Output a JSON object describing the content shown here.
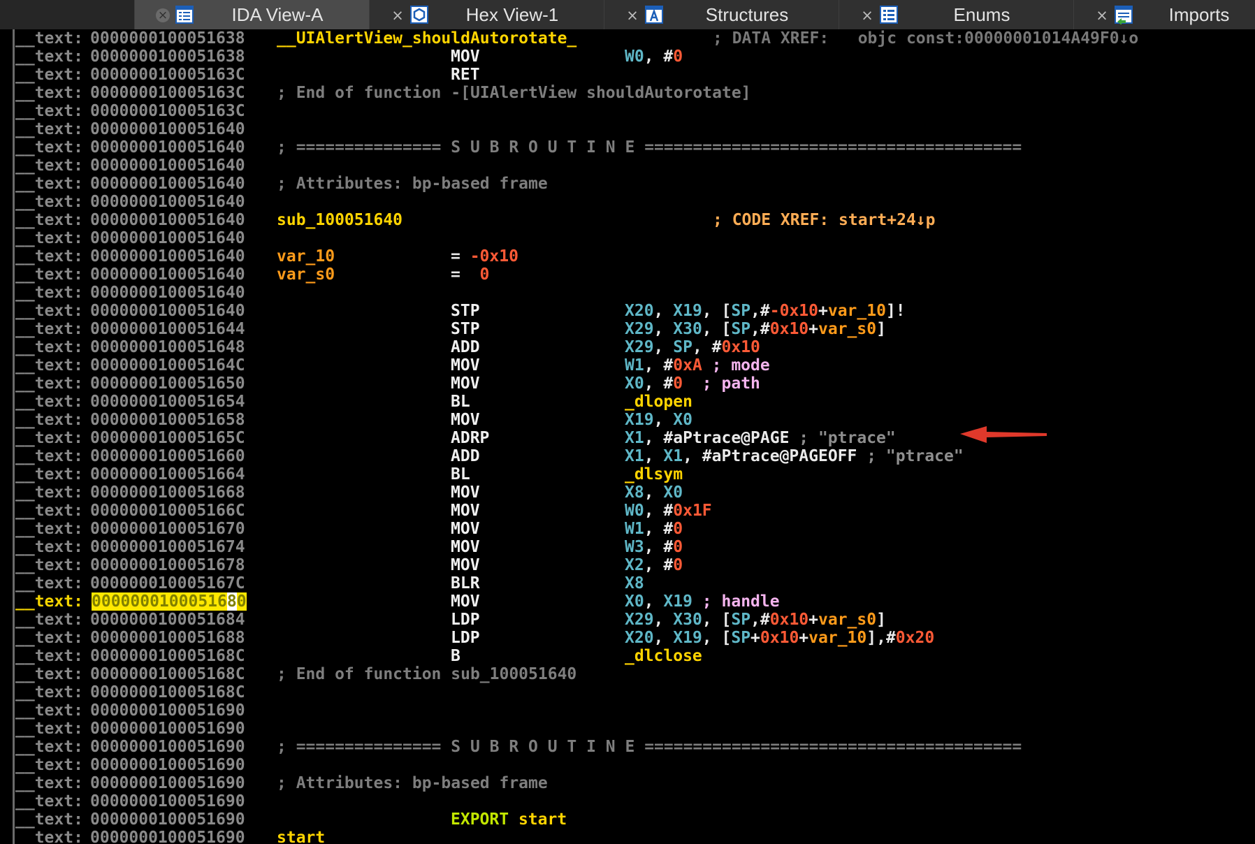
{
  "tabs": [
    {
      "label": "IDA View-A",
      "icon": "ida-view-icon",
      "active": true
    },
    {
      "label": "Hex View-1",
      "icon": "hex-view-icon",
      "active": false
    },
    {
      "label": "Structures",
      "icon": "structures-icon",
      "active": false
    },
    {
      "label": "Enums",
      "icon": "enums-icon",
      "active": false
    },
    {
      "label": "Imports",
      "icon": "imports-icon",
      "active": false
    }
  ],
  "close_glyph": "×",
  "segment": "__text:",
  "highlighted_line": {
    "addr_before_cursor": "00000001000516",
    "cursor_char": "8",
    "addr_after_cursor": "0"
  },
  "lines": [
    {
      "addr": "000000010005163 8",
      "label": "__UIAlertView_shouldAutorotate_",
      "xref": "; DATA XREF:   objc const:00000001014A49F0↓o"
    },
    {
      "addr": "0000000100051638",
      "mnem": "MOV",
      "ops": "W0, #0"
    },
    {
      "addr": "000000010005163C",
      "mnem": "RET"
    },
    {
      "addr": "000000010005163C",
      "comment": "; End of function -[UIAlertView shouldAutorotate]"
    },
    {
      "addr": "000000010005163C"
    },
    {
      "addr": "0000000100051640"
    },
    {
      "addr": "0000000100051640",
      "comment": "; =============== S U B R O U T I N E ======================================="
    },
    {
      "addr": "0000000100051640"
    },
    {
      "addr": "0000000100051640",
      "comment": "; Attributes: bp-based frame"
    },
    {
      "addr": "0000000100051640"
    },
    {
      "addr": "0000000100051640",
      "label": "sub_100051640",
      "xref": "; CODE XREF: start+24↓p"
    },
    {
      "addr": "0000000100051640"
    },
    {
      "addr": "0000000100051640",
      "label": "var_10",
      "mnem": "= -0x10"
    },
    {
      "addr": "0000000100051640",
      "label": "var_s0",
      "mnem": "=  0"
    },
    {
      "addr": "0000000100051640"
    },
    {
      "addr": "0000000100051640",
      "mnem": "STP",
      "ops": "X20, X19, [SP,#-0x10+var_10]!"
    },
    {
      "addr": "0000000100051644",
      "mnem": "STP",
      "ops": "X29, X30, [SP,#0x10+var_s0]"
    },
    {
      "addr": "0000000100051648",
      "mnem": "ADD",
      "ops": "X29, SP, #0x10"
    },
    {
      "addr": "000000010005164C",
      "mnem": "MOV",
      "ops": "W1, #0xA ; mode"
    },
    {
      "addr": "0000000100051650",
      "mnem": "MOV",
      "ops": "X0, #0  ; path"
    },
    {
      "addr": "0000000100051654",
      "mnem": "BL",
      "ops": "_dlopen"
    },
    {
      "addr": "0000000100051658",
      "mnem": "MOV",
      "ops": "X19, X0"
    },
    {
      "addr": "000000010005165C",
      "mnem": "ADRP",
      "ops": "X1, #aPtrace@PAGE ; \"ptrace\""
    },
    {
      "addr": "0000000100051660",
      "mnem": "ADD",
      "ops": "X1, X1, #aPtrace@PAGEOFF ; \"ptrace\""
    },
    {
      "addr": "0000000100051664",
      "mnem": "BL",
      "ops": "_dlsym"
    },
    {
      "addr": "0000000100051668",
      "mnem": "MOV",
      "ops": "X8, X0"
    },
    {
      "addr": "000000010005166C",
      "mnem": "MOV",
      "ops": "W0, #0x1F"
    },
    {
      "addr": "0000000100051670",
      "mnem": "MOV",
      "ops": "W1, #0"
    },
    {
      "addr": "0000000100051674",
      "mnem": "MOV",
      "ops": "W3, #0"
    },
    {
      "addr": "0000000100051678",
      "mnem": "MOV",
      "ops": "X2, #0"
    },
    {
      "addr": "000000010005167C",
      "mnem": "BLR",
      "ops": "X8"
    },
    {
      "addr": "0000000100051680",
      "mnem": "MOV",
      "ops": "X0, X19 ; handle"
    },
    {
      "addr": "0000000100051684",
      "mnem": "LDP",
      "ops": "X29, X30, [SP,#0x10+var_s0]"
    },
    {
      "addr": "0000000100051688",
      "mnem": "LDP",
      "ops": "X20, X19, [SP+0x10+var_10],#0x20"
    },
    {
      "addr": "000000010005168C",
      "mnem": "B",
      "ops": "_dlclose"
    },
    {
      "addr": "000000010005168C",
      "comment": "; End of function sub_100051640"
    },
    {
      "addr": "000000010005168C"
    },
    {
      "addr": "0000000100051690"
    },
    {
      "addr": "0000000100051690"
    },
    {
      "addr": "0000000100051690",
      "comment": "; =============== S U B R O U T I N E ======================================="
    },
    {
      "addr": "0000000100051690"
    },
    {
      "addr": "0000000100051690",
      "comment": "; Attributes: bp-based frame"
    },
    {
      "addr": "0000000100051690"
    },
    {
      "addr": "0000000100051690",
      "mnem": "EXPORT start"
    },
    {
      "addr": "0000000100051690",
      "label": "start"
    },
    {
      "addr": "0000000100051690"
    }
  ],
  "arrow_color": "#e0392b"
}
